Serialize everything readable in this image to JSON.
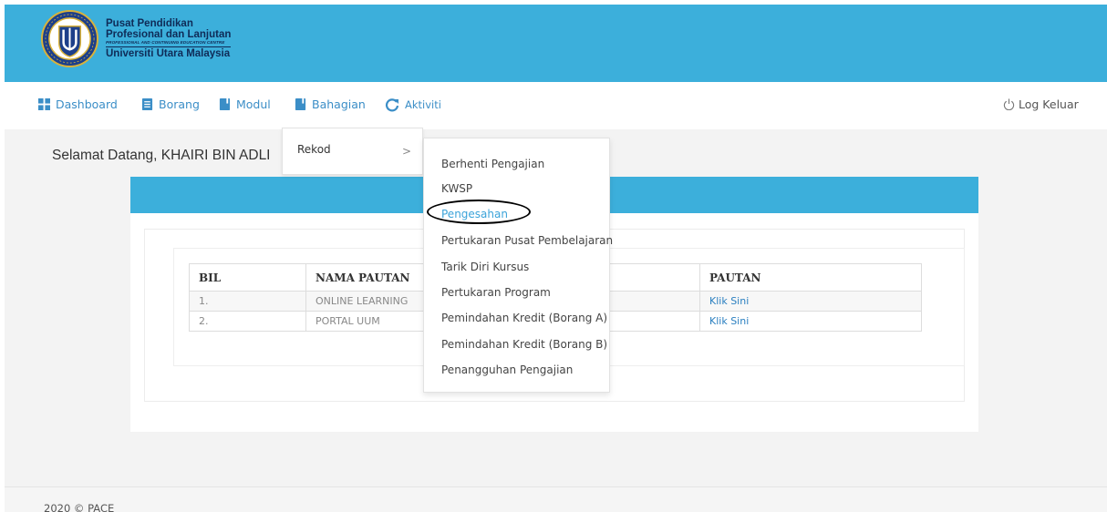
{
  "header": {
    "logo": {
      "line1": "Pusat Pendidikan",
      "line2": "Profesional dan Lanjutan",
      "line3": "PROFESSIONAL AND CONTINUING EDUCATION CENTRE",
      "line4": "Universiti Utara Malaysia"
    },
    "accent_color": "#3cafdb"
  },
  "nav": {
    "items": [
      {
        "label": "Dashboard",
        "icon": "dashboard-grid-icon"
      },
      {
        "label": "Borang",
        "icon": "document-icon"
      },
      {
        "label": "Modul",
        "icon": "book-icon"
      },
      {
        "label": "Bahagian",
        "icon": "book-icon"
      },
      {
        "label": "Aktiviti",
        "icon": "refresh-icon"
      }
    ],
    "logout_label": "Log Keluar",
    "logout_icon": "power-icon"
  },
  "main": {
    "welcome": "Selamat Datang, KHAIRI BIN ADLI"
  },
  "table": {
    "headers": [
      "BIL",
      "NAMA PAUTAN",
      "PAUTAN"
    ],
    "rows": [
      {
        "bil": "1.",
        "nama": "ONLINE LEARNING",
        "pautan": "Klik Sini"
      },
      {
        "bil": "2.",
        "nama": "PORTAL UUM",
        "pautan": "Klik Sini"
      }
    ]
  },
  "menu": {
    "level1": {
      "label": "Rekod",
      "chevron": ">"
    },
    "level2": [
      "Berhenti Pengajian",
      "KWSP",
      "Pengesahan",
      "Pertukaran Pusat Pembelajaran",
      "Tarik Diri Kursus",
      "Pertukaran Program",
      "Pemindahan Kredit (Borang A)",
      "Pemindahan Kredit (Borang B)",
      "Penangguhan Pengajian"
    ],
    "active_index": 2
  },
  "footer": {
    "text": "2020 © PACE"
  }
}
